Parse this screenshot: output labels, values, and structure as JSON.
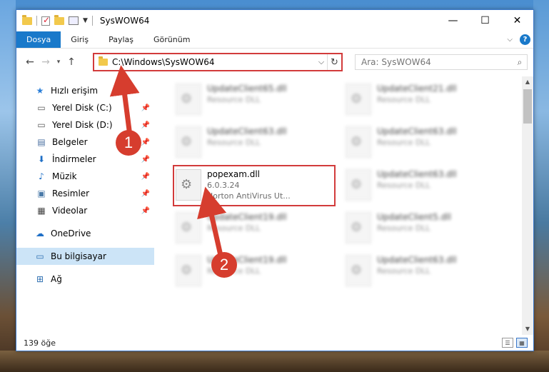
{
  "window": {
    "title": "SysWOW64",
    "controls": [
      "—",
      "☐",
      "✕"
    ]
  },
  "ribbon": {
    "tabs": [
      "Dosya",
      "Giriş",
      "Paylaş",
      "Görünüm"
    ],
    "help": "?"
  },
  "nav": {
    "back": "←",
    "forward": "→",
    "recent": "▾",
    "up": "↑",
    "address": "C:\\Windows\\SysWOW64",
    "address_dropdown": "⌵",
    "refresh": "↻",
    "search_placeholder": "Ara: SysWOW64"
  },
  "sidebar": {
    "quick_access": "Hızlı erişim",
    "items": [
      {
        "label": "Yerel Disk (C:)",
        "icon": "drive-icon"
      },
      {
        "label": "Yerel Disk (D:)",
        "icon": "drive-icon"
      },
      {
        "label": "Belgeler",
        "icon": "documents-icon"
      },
      {
        "label": "İndirmeler",
        "icon": "downloads-icon"
      },
      {
        "label": "Müzik",
        "icon": "music-icon"
      },
      {
        "label": "Resimler",
        "icon": "pictures-icon"
      },
      {
        "label": "Videolar",
        "icon": "videos-icon"
      }
    ],
    "onedrive": "OneDrive",
    "this_pc": "Bu bilgisayar",
    "network": "Ağ"
  },
  "files": {
    "left": [
      {
        "name": "UpdateClient65.dll",
        "sub": "Resource DLL"
      },
      {
        "name": "UpdateClient63.dll",
        "sub": "Resource DLL"
      },
      {
        "name": "popexam.dll",
        "version": "6.0.3.24",
        "desc": "Norton AntiVirus Ut..."
      },
      {
        "name": "UpdateClient19.dll",
        "sub": "Resource DLL"
      },
      {
        "name": "UpdateClient19.dll",
        "sub": "Resource DLL"
      }
    ],
    "right": [
      {
        "name": "UpdateClient21.dll",
        "sub": "Resource DLL"
      },
      {
        "name": "UpdateClient63.dll",
        "sub": "Resource DLL"
      },
      {
        "name": "UpdateClient63.dll",
        "sub": "Resource DLL"
      },
      {
        "name": "UpdateClient5.dll",
        "sub": "Resource DLL"
      },
      {
        "name": "UpdateClient63.dll",
        "sub": "Resource DLL"
      }
    ]
  },
  "status": {
    "count": "139 öğe"
  },
  "annotations": {
    "step1": "1",
    "step2": "2",
    "color": "#d63d2e"
  }
}
